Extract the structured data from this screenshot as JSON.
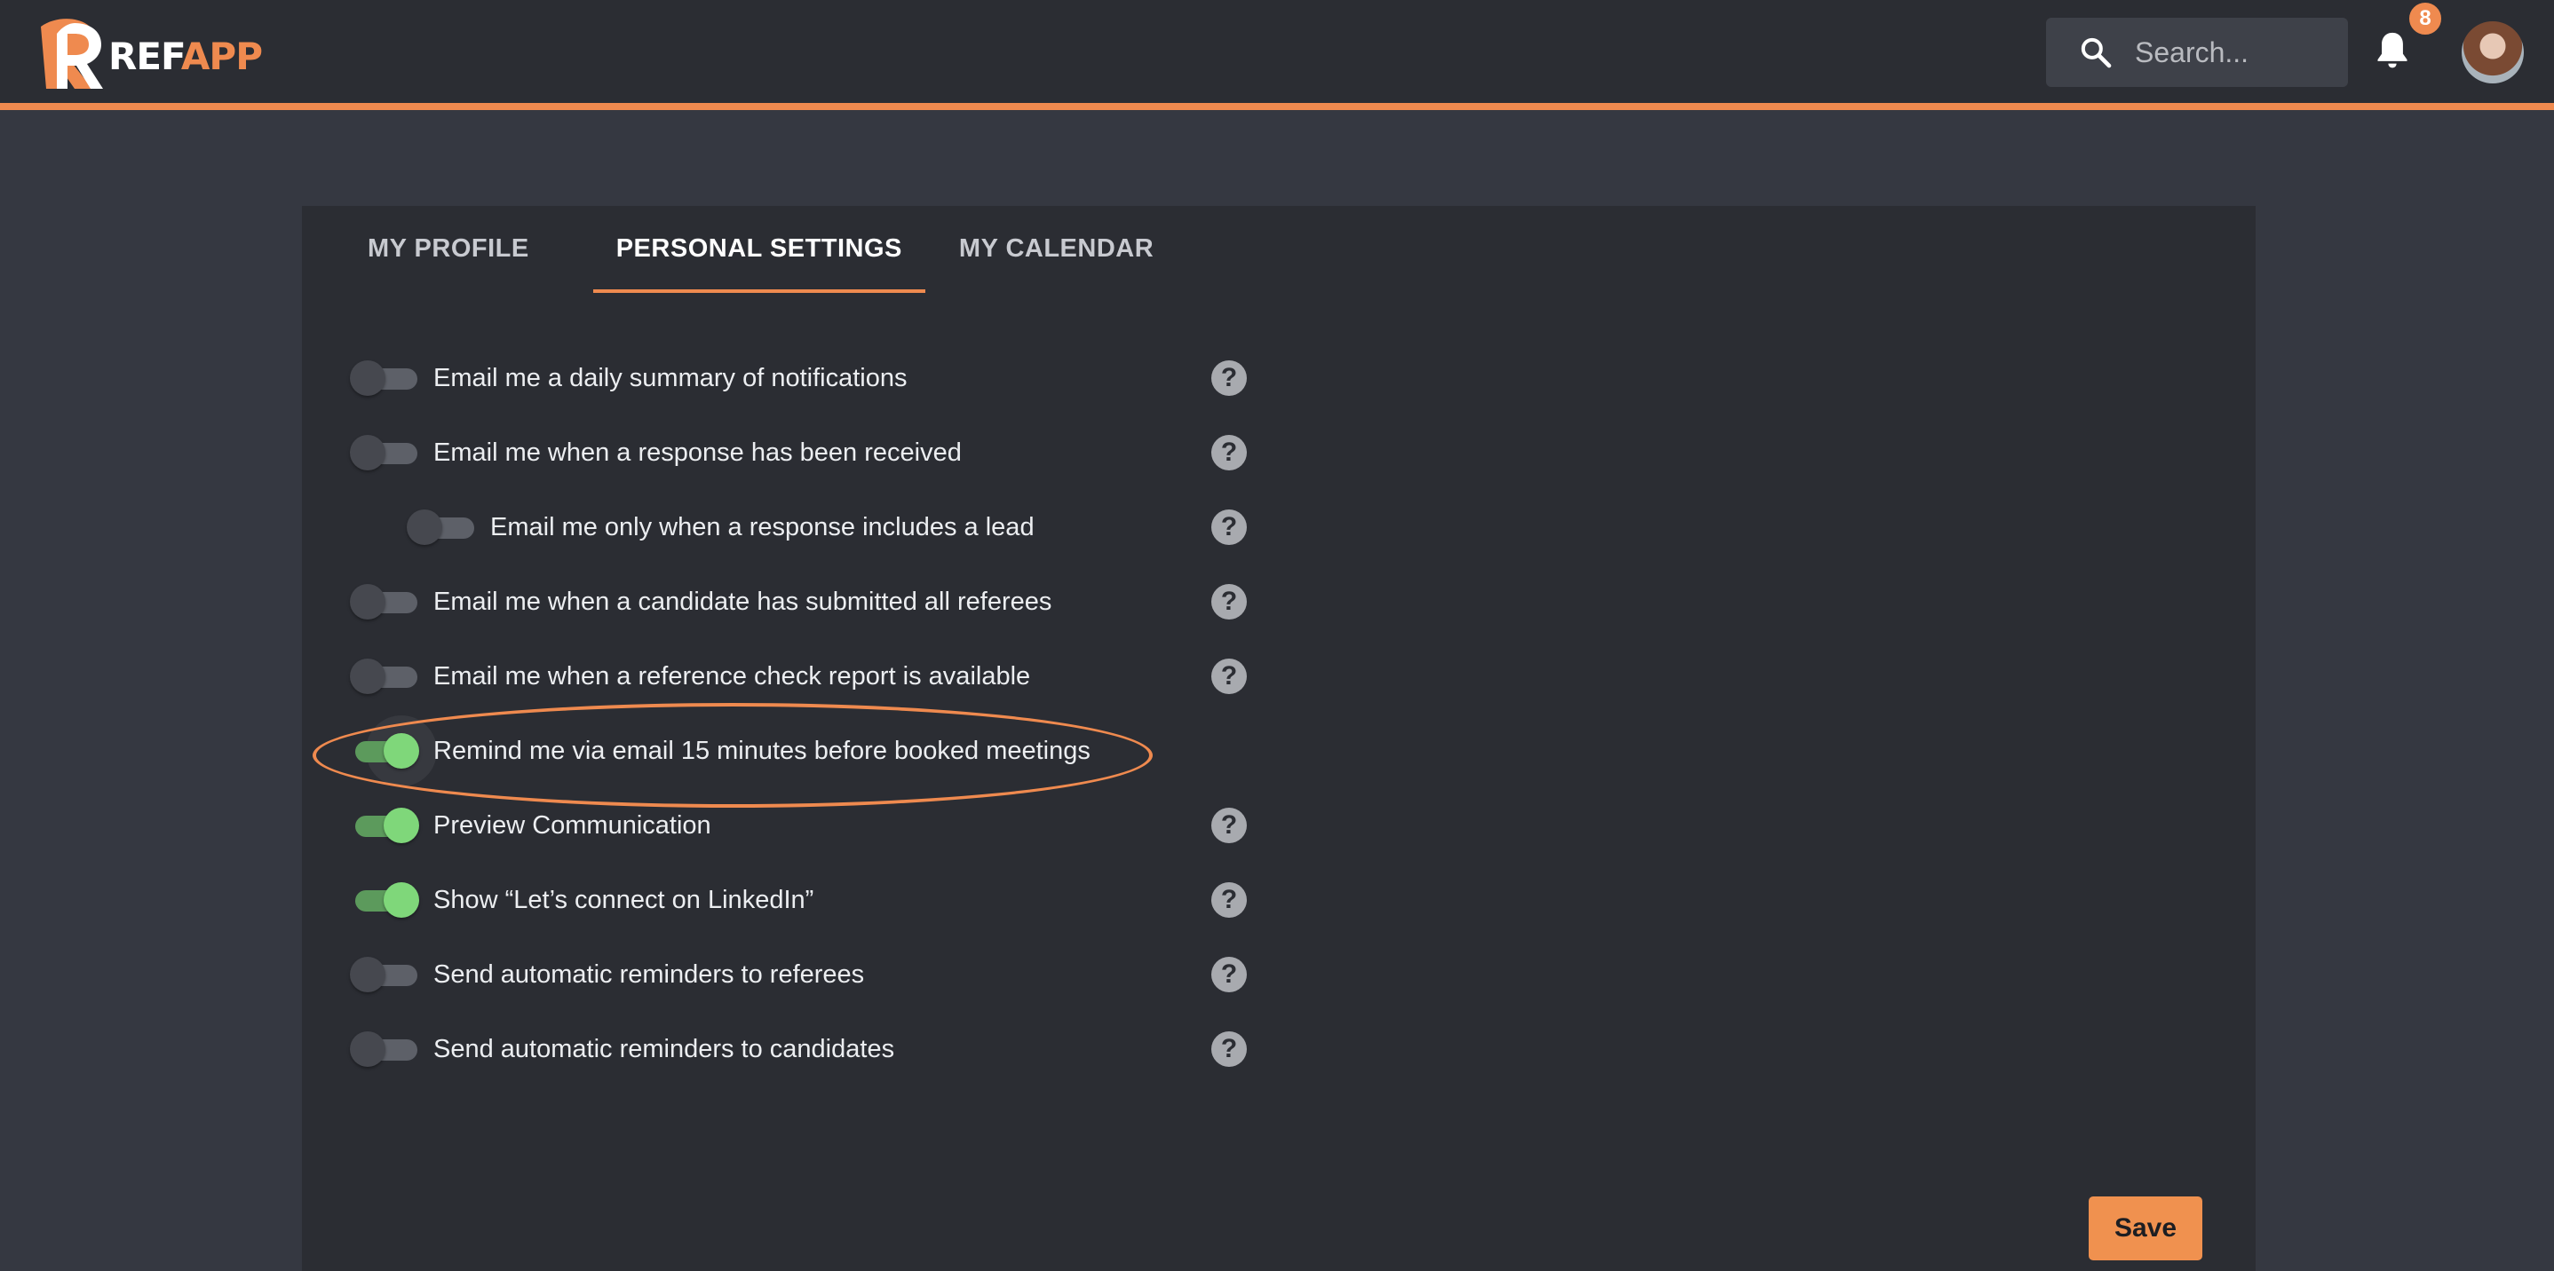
{
  "header": {
    "logo_ref": "REF",
    "logo_app": "APP",
    "search_placeholder": "Search...",
    "notification_count": "8"
  },
  "tabs": [
    {
      "label": "MY PROFILE",
      "active": false
    },
    {
      "label": "PERSONAL SETTINGS",
      "active": true
    },
    {
      "label": "MY CALENDAR",
      "active": false
    }
  ],
  "settings": [
    {
      "label": "Email me a daily summary of notifications",
      "on": false,
      "help": true
    },
    {
      "label": "Email me when a response has been received",
      "on": false,
      "help": true
    },
    {
      "label": "Email me only when a response includes a lead",
      "on": false,
      "help": true,
      "indent": true
    },
    {
      "label": "Email me when a candidate has submitted all referees",
      "on": false,
      "help": true
    },
    {
      "label": "Email me when a reference check report is available",
      "on": false,
      "help": true
    },
    {
      "label": "Remind me via email 15 minutes before booked meetings",
      "on": true,
      "help": false
    },
    {
      "label": "Preview Communication",
      "on": true,
      "help": true
    },
    {
      "label": "Show “Let’s connect on LinkedIn”",
      "on": true,
      "help": true
    },
    {
      "label": "Send automatic reminders to referees",
      "on": false,
      "help": true
    },
    {
      "label": "Send automatic reminders to candidates",
      "on": false,
      "help": true
    }
  ],
  "help_symbol": "?",
  "save_label": "Save",
  "colors": {
    "accent": "#ef8a4f",
    "toggle_on": "#7fd77a",
    "background": "#353841",
    "panel": "#2b2d33"
  }
}
